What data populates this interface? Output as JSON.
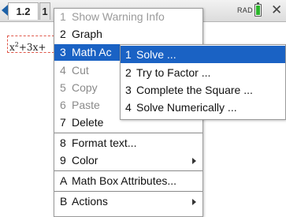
{
  "topbar": {
    "active_tab": "1.2",
    "next_tab": "1",
    "angle_mode": "RAD",
    "colors": {
      "accent": "#1e62a8",
      "battery": "#2bb52b"
    }
  },
  "document": {
    "math_expression_base": "x",
    "math_expression_exp": "2",
    "math_expression_rest": "+3x+"
  },
  "menu": {
    "items": [
      {
        "num": "1",
        "label": "Show Warning Info",
        "state": "faded"
      },
      {
        "num": "2",
        "label": "Graph",
        "state": "normal"
      },
      {
        "num": "3",
        "label": "Math Ac",
        "state": "highlight"
      },
      {
        "num": "4",
        "label": "Cut",
        "state": "disabled"
      },
      {
        "num": "5",
        "label": "Copy",
        "state": "disabled"
      },
      {
        "num": "6",
        "label": "Paste",
        "state": "disabled"
      },
      {
        "num": "7",
        "label": "Delete",
        "state": "normal"
      },
      {
        "num": "8",
        "label": "Format text...",
        "state": "normal"
      },
      {
        "num": "9",
        "label": "Color",
        "state": "normal"
      },
      {
        "num": "A",
        "label": "Math Box Attributes...",
        "state": "normal"
      },
      {
        "num": "B",
        "label": "Actions",
        "state": "normal"
      }
    ],
    "colors": {
      "highlight": "#1a62c4"
    }
  },
  "submenu": {
    "items": [
      {
        "num": "1",
        "label": "Solve ..."
      },
      {
        "num": "2",
        "label": "Try to Factor ..."
      },
      {
        "num": "3",
        "label": "Complete the Square ..."
      },
      {
        "num": "4",
        "label": "Solve Numerically ..."
      }
    ]
  },
  "icons": [
    "tab-back-arrow-icon",
    "battery-icon",
    "close-icon",
    "submenu-arrow-icon"
  ]
}
